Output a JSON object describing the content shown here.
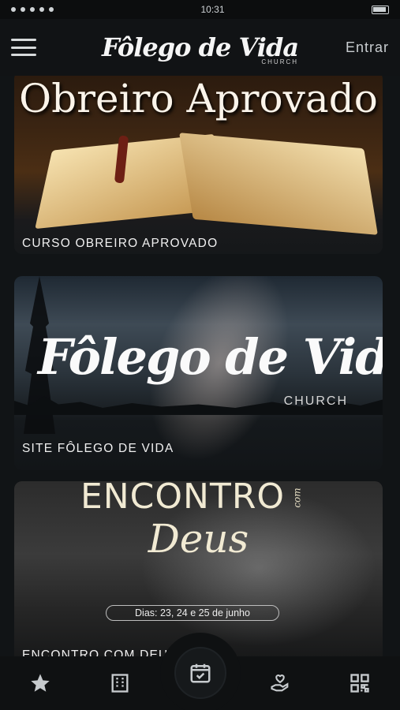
{
  "status_bar": {
    "time": "10:31"
  },
  "header": {
    "menu_icon": "hamburger-icon",
    "logo_text": "Fôlego de Vida",
    "logo_sub": "CHURCH",
    "login_label": "Entrar"
  },
  "feed": {
    "cards": [
      {
        "banner_text": "Obreiro Aprovado",
        "title": "CURSO OBREIRO APROVADO"
      },
      {
        "banner_text": "Fôlego de Vida",
        "banner_sub": "CHURCH",
        "title": "SITE FÔLEGO DE VIDA"
      },
      {
        "banner_text_top": "ENCONTRO",
        "banner_text_script": "Deus",
        "banner_text_small": "com",
        "banner_dates": "Dias: 23, 24 e 25 de junho",
        "title": "ENCONTRO COM DEUS"
      }
    ]
  },
  "tabbar": {
    "tabs": [
      {
        "icon": "star-icon"
      },
      {
        "icon": "building-icon"
      },
      {
        "icon": "calendar-check-icon"
      },
      {
        "icon": "heart-hand-icon"
      },
      {
        "icon": "qr-code-icon"
      }
    ]
  },
  "colors": {
    "background": "#111416",
    "text_primary": "#f0f0f0",
    "tab_icon": "#c7cbce"
  }
}
